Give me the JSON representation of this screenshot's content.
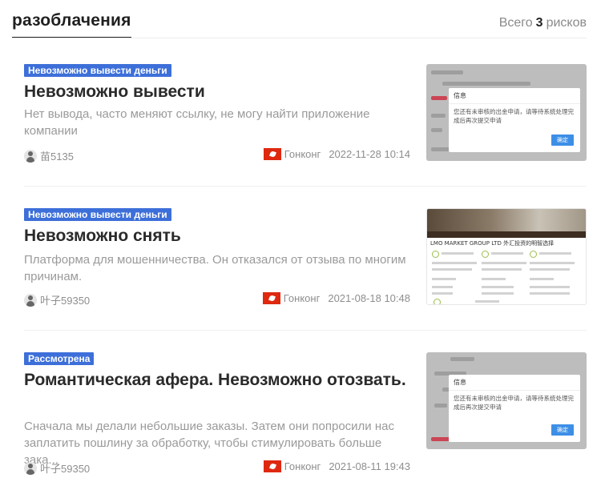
{
  "header": {
    "tab_title": "разоблачения",
    "count_prefix": "Всего",
    "count_value": "3",
    "count_suffix": "рисков"
  },
  "items": [
    {
      "badge": "Невозможно вывести деньги",
      "title": "Невозможно вывести",
      "description": "Нет вывода, часто меняют ссылку, не могу найти приложение компании",
      "user": "苗5135",
      "region": "Гонконг",
      "date": "2022-11-28 10:14",
      "thumb": {
        "dialog_title": "信息",
        "dialog_text": "您还有未审核的出金申请，请等待系统处理完成后再次提交申请",
        "dialog_button": "确定"
      }
    },
    {
      "badge": "Невозможно вывести деньги",
      "title": "Невозможно снять",
      "description": "Платформа для мошенничества. Он отказался от отзыва по многим причинам.",
      "user": "叶子59350",
      "region": "Гонконг",
      "date": "2021-08-18 10:48",
      "thumb": {
        "company_text": "LMO MARKET GROUP LTD 外汇投资的明智选择"
      }
    },
    {
      "badge": "Рассмотрена",
      "title": "Романтическая афера. Невозможно отозвать.",
      "description": "Сначала мы делали небольшие заказы. Затем они попросили нас заплатить пошлину за обработку, чтобы стимулировать больше зака...",
      "user": "叶子59350",
      "region": "Гонконг",
      "date": "2021-08-11 19:43",
      "thumb": {
        "dialog_title": "信息",
        "dialog_text": "您还有未审核的出金申请，请等待系统处理完成后再次提交申请",
        "dialog_button": "确定"
      }
    }
  ],
  "colors": {
    "badge": "#3d6fd9",
    "flag": "#de2910",
    "muted_text": "#9a9a9a"
  },
  "icons": {
    "avatar": "user-avatar-icon",
    "flag": "hong-kong-flag-icon"
  }
}
